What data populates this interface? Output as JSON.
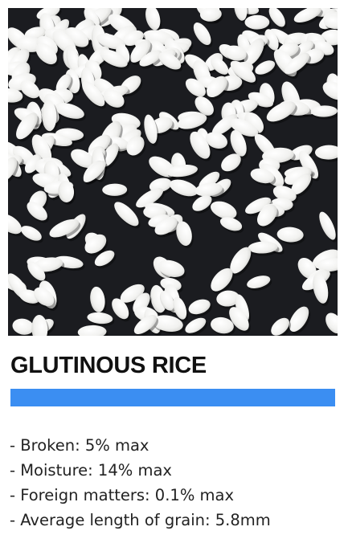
{
  "photo": {
    "subject": "glutinous-rice-grains",
    "background_color": "#1b1c20",
    "grain_color": "#f4f4f2"
  },
  "product": {
    "title": "GLUTINOUS RICE"
  },
  "accent_color": "#3b8ef2",
  "specs": [
    "- Broken: 5% max",
    "- Moisture: 14% max",
    "- Foreign matters: 0.1% max",
    "- Average length of grain: 5.8mm"
  ]
}
